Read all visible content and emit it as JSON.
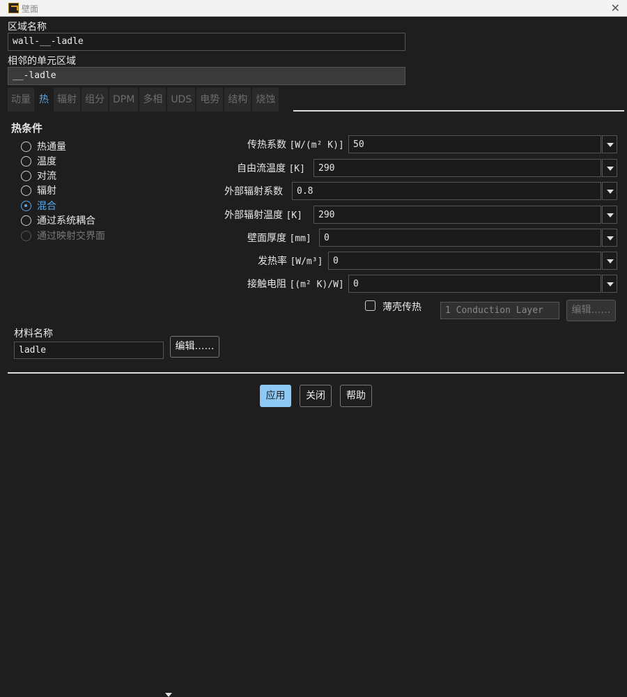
{
  "window": {
    "title": "壁面",
    "close": "✕"
  },
  "zone_name": {
    "label": "区域名称",
    "value": "wall-__-ladle"
  },
  "adjacent": {
    "label": "相邻的单元区域",
    "value": "__-ladle"
  },
  "tabs": [
    "动量",
    "热",
    "辐射",
    "组分",
    "DPM",
    "多相",
    "UDS",
    "电势",
    "结构",
    "烧蚀"
  ],
  "active_tab": "热",
  "thermal": {
    "title": "热条件",
    "options": [
      "热通量",
      "温度",
      "对流",
      "辐射",
      "混合",
      "通过系统耦合",
      "通过映射交界面"
    ],
    "selected": "混合",
    "disabled": [
      "通过映射交界面"
    ]
  },
  "params": [
    {
      "label": "传热系数",
      "unit": "[W/(m² K)]",
      "value": "50"
    },
    {
      "label": "自由流温度",
      "unit": "[K]",
      "value": "290"
    },
    {
      "label": "外部辐射系数",
      "unit": "",
      "value": "0.8"
    },
    {
      "label": "外部辐射温度",
      "unit": "[K]",
      "value": "290"
    },
    {
      "label": "壁面厚度",
      "unit": "[mm]",
      "value": "0"
    },
    {
      "label": "发热率",
      "unit": "[W/m³]",
      "value": "0"
    },
    {
      "label": "接触电阻",
      "unit": "[(m² K)/W]",
      "value": "0"
    }
  ],
  "shell": {
    "label": "薄壳传热",
    "checked": false,
    "layers": "1 Conduction Layer",
    "edit": "编辑……"
  },
  "material": {
    "label": "材料名称",
    "value": "ladle",
    "edit": "编辑……"
  },
  "buttons": {
    "apply": "应用",
    "close": "关闭",
    "help": "帮助"
  }
}
